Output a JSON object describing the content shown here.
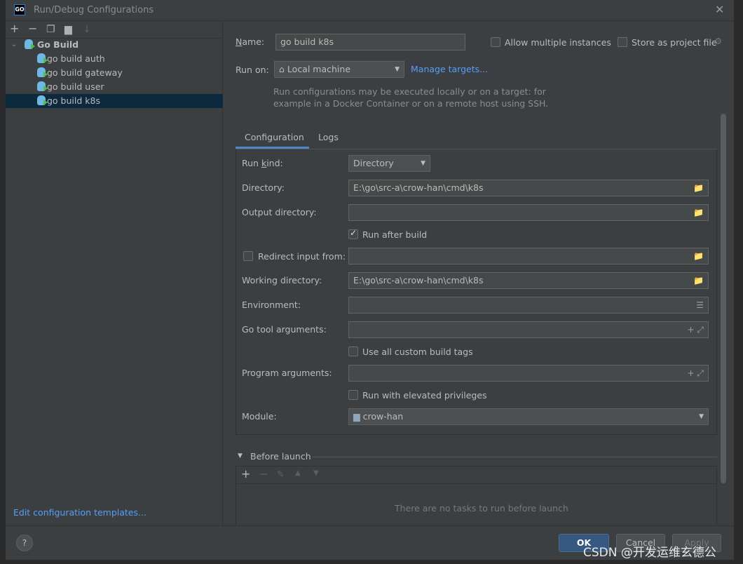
{
  "window": {
    "title": "Run/Debug Configurations",
    "app_icon": "GO"
  },
  "left": {
    "toolbar": [
      "add-icon",
      "remove-icon",
      "copy-icon",
      "new-folder-icon",
      "sort-icon"
    ],
    "tree": {
      "group": "Go Build",
      "items": [
        "go build auth",
        "go build gateway",
        "go build user",
        "go build k8s"
      ],
      "selected": "go build k8s"
    },
    "templates_link": "Edit configuration templates..."
  },
  "form": {
    "name_label": "Name:",
    "name_value": "go build k8s",
    "allow_multiple": "Allow multiple instances",
    "store_project": "Store as project file",
    "run_on_label": "Run on:",
    "run_on_value": "Local machine",
    "manage_targets": "Manage targets...",
    "hint_line1": "Run configurations may be executed locally or on a target: for",
    "hint_line2": "example in a Docker Container or on a remote host using SSH.",
    "tabs": [
      "Configuration",
      "Logs"
    ],
    "run_kind_label": "Run kind:",
    "run_kind_value": "Directory",
    "directory_label": "Directory:",
    "directory_value": "E:\\go\\src-a\\crow-han\\cmd\\k8s",
    "output_label": "Output directory:",
    "output_value": "",
    "run_after_build": "Run after build",
    "redirect_label": "Redirect input from:",
    "redirect_value": "",
    "working_label": "Working directory:",
    "working_value": "E:\\go\\src-a\\crow-han\\cmd\\k8s",
    "env_label": "Environment:",
    "env_value": "",
    "gotool_label": "Go tool arguments:",
    "gotool_value": "",
    "custom_tags": "Use all custom build tags",
    "program_label": "Program arguments:",
    "program_value": "",
    "elevated": "Run with elevated privileges",
    "module_label": "Module:",
    "module_value": "crow-han",
    "before_launch": "Before launch",
    "no_tasks": "There are no tasks to run before launch"
  },
  "footer": {
    "help": "?",
    "ok": "OK",
    "cancel": "Cancel",
    "apply": "Apply"
  },
  "watermark": "CSDN @开发运维玄德公"
}
